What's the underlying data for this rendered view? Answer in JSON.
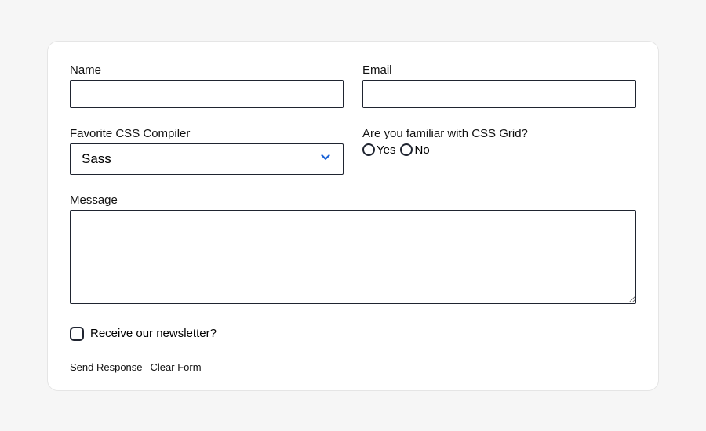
{
  "form": {
    "name": {
      "label": "Name",
      "value": ""
    },
    "email": {
      "label": "Email",
      "value": ""
    },
    "compiler": {
      "label": "Favorite CSS Compiler",
      "selected": "Sass"
    },
    "grid_familiar": {
      "question": "Are you familiar with CSS Grid?",
      "options": {
        "yes": "Yes",
        "no": "No"
      }
    },
    "message": {
      "label": "Message",
      "value": ""
    },
    "newsletter": {
      "label": "Receive our newsletter?",
      "checked": false
    },
    "actions": {
      "submit": "Send Response",
      "reset": "Clear Form"
    }
  }
}
